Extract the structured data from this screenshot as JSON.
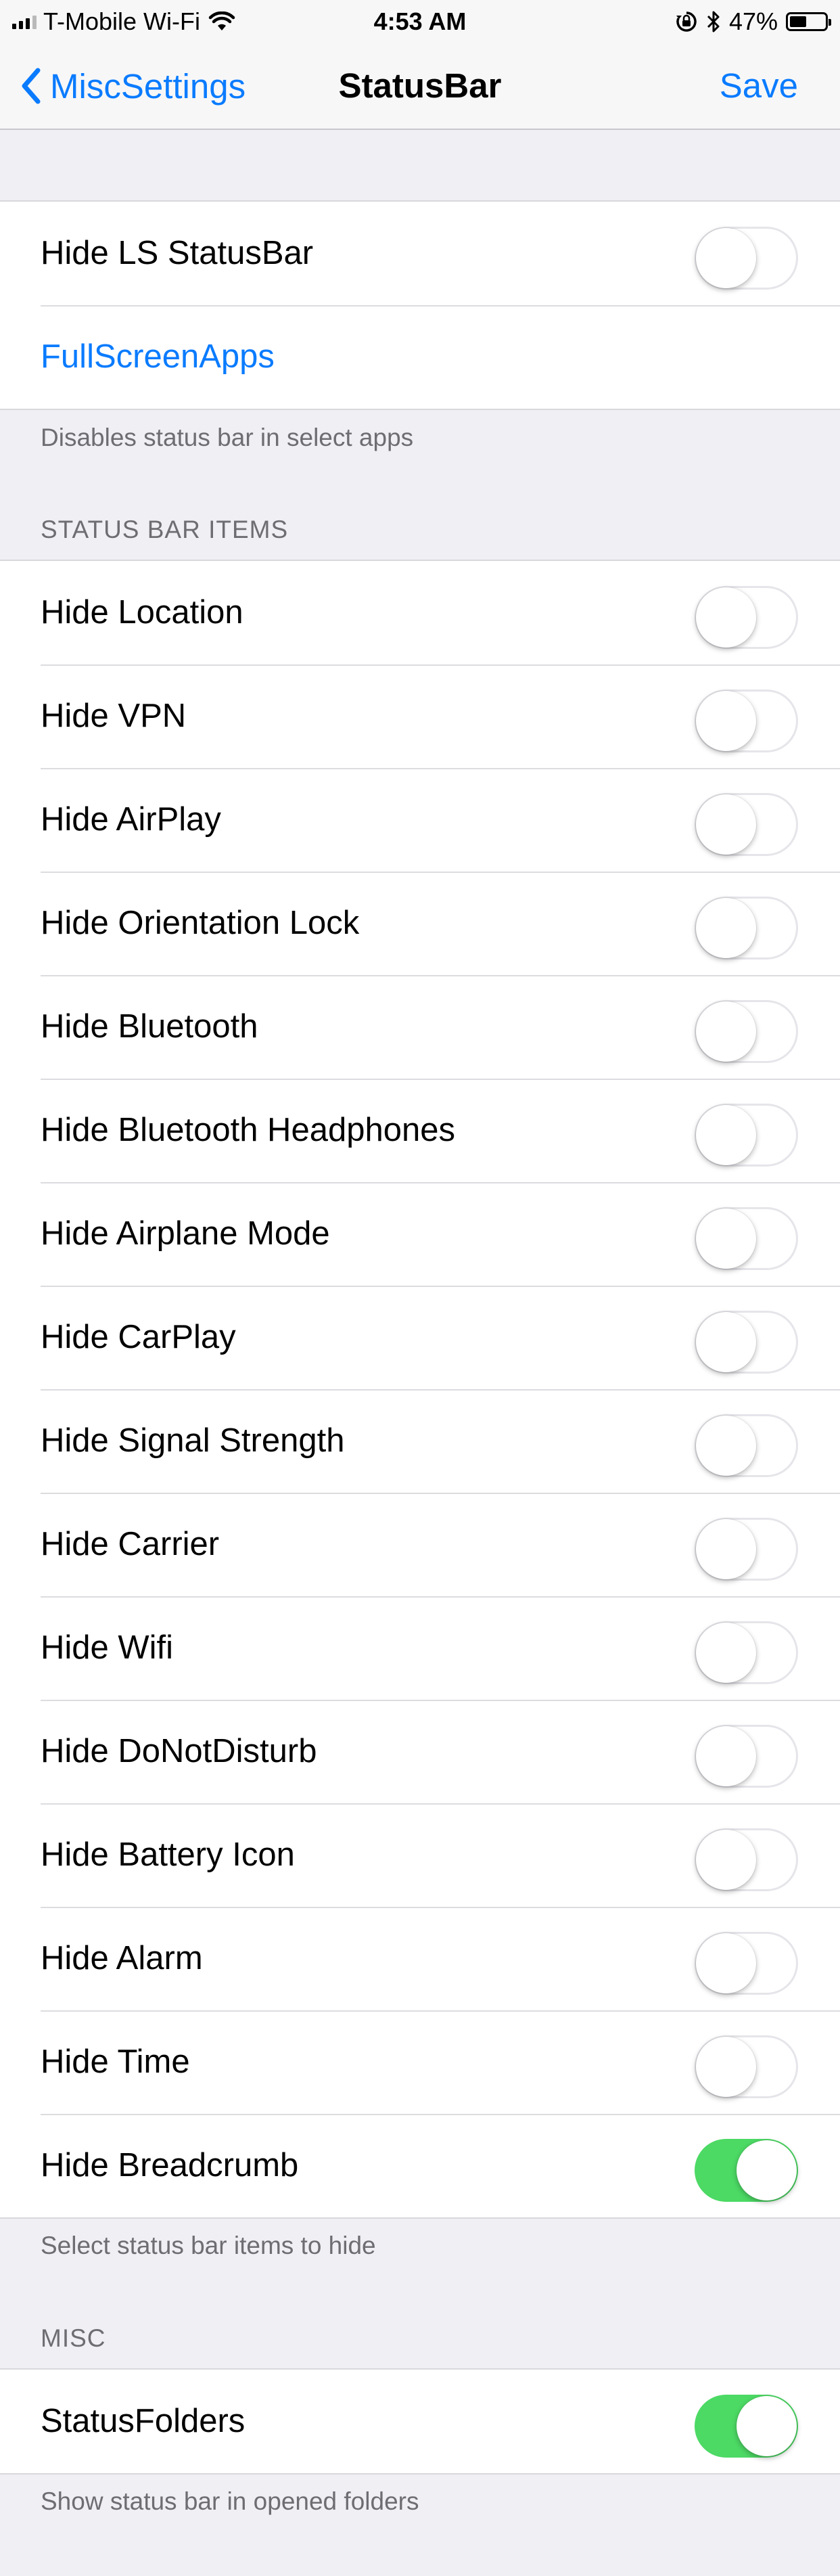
{
  "status_bar": {
    "carrier": "T-Mobile Wi-Fi",
    "time": "4:53 AM",
    "battery_percent": "47%",
    "battery_level": 0.47,
    "icons": [
      "signal-bars-icon",
      "wifi-icon",
      "orientation-lock-icon",
      "bluetooth-icon",
      "battery-icon"
    ]
  },
  "nav": {
    "back_label": "MiscSettings",
    "title": "StatusBar",
    "save_label": "Save"
  },
  "colors": {
    "accent": "#0a7bff",
    "toggle_on": "#4cd964",
    "background": "#efeff4"
  },
  "group1": {
    "rows": [
      {
        "label": "Hide LS StatusBar",
        "type": "toggle",
        "on": false
      },
      {
        "label": "FullScreenApps",
        "type": "link"
      }
    ],
    "footer": "Disables status bar in select apps"
  },
  "items_section": {
    "header": "STATUS BAR ITEMS",
    "rows": [
      {
        "label": "Hide Location",
        "on": false
      },
      {
        "label": "Hide VPN",
        "on": false
      },
      {
        "label": "Hide AirPlay",
        "on": false
      },
      {
        "label": "Hide Orientation Lock",
        "on": false
      },
      {
        "label": "Hide Bluetooth",
        "on": false
      },
      {
        "label": "Hide Bluetooth Headphones",
        "on": false
      },
      {
        "label": "Hide Airplane Mode",
        "on": false
      },
      {
        "label": "Hide CarPlay",
        "on": false
      },
      {
        "label": "Hide Signal Strength",
        "on": false
      },
      {
        "label": "Hide Carrier",
        "on": false
      },
      {
        "label": "Hide Wifi",
        "on": false
      },
      {
        "label": "Hide DoNotDisturb",
        "on": false
      },
      {
        "label": "Hide Battery Icon",
        "on": false
      },
      {
        "label": "Hide Alarm",
        "on": false
      },
      {
        "label": "Hide Time",
        "on": false
      },
      {
        "label": "Hide Breadcrumb",
        "on": true
      }
    ],
    "footer": "Select status bar items to hide"
  },
  "misc_section": {
    "header": "MISC",
    "rows": [
      {
        "label": "StatusFolders",
        "on": true
      }
    ],
    "footer": "Show status bar in opened folders"
  }
}
